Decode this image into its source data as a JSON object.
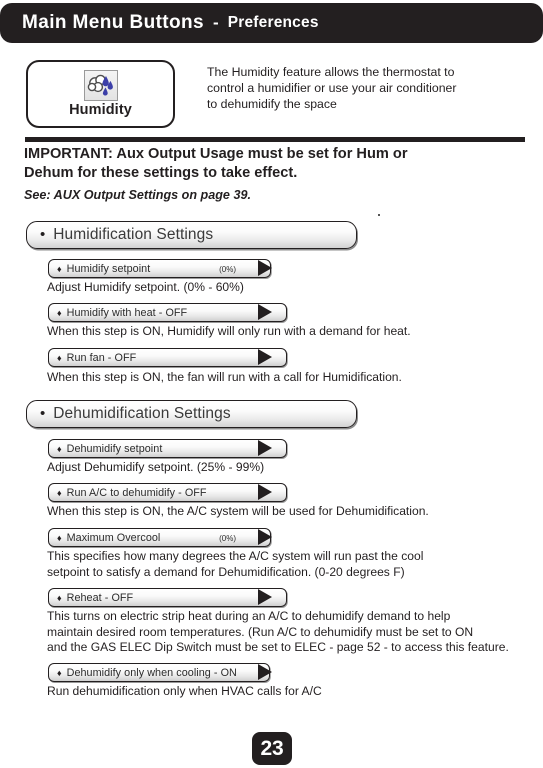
{
  "header": {
    "title": "Main Menu Buttons",
    "separator": "-",
    "subtitle": "Preferences"
  },
  "feature": {
    "icon_name": "humidity-cloud-raindrops-icon",
    "label": "Humidity",
    "description_lines": [
      "The Humidity feature allows the thermostat to",
      "control a humidifier or use your air conditioner",
      "to dehumidify the space"
    ]
  },
  "notice": {
    "important_lines": [
      "IMPORTANT: Aux Output Usage must be set for Hum or",
      "Dehum for these settings to take effect."
    ],
    "see_reference": "See: AUX Output Settings on page 39."
  },
  "sections": [
    {
      "bullet": "•",
      "title": "Humidification Settings",
      "settings": [
        {
          "bullet": "♦",
          "label": "Humidify setpoint",
          "value": "(0%)",
          "arrow": "▶",
          "description_lines": [
            "Adjust Humidify setpoint. (0% - 60%)"
          ]
        },
        {
          "bullet": "♦",
          "label": "Humidify with heat - OFF",
          "value": "",
          "arrow": "▶",
          "description_lines": [
            "When this step is ON, Humidify will only run with a demand for heat."
          ]
        },
        {
          "bullet": "♦",
          "label": "Run fan - OFF",
          "value": "",
          "arrow": "▶",
          "description_lines": [
            "When this step is ON, the fan will run with a call for Humidification."
          ]
        }
      ]
    },
    {
      "bullet": "•",
      "title": "Dehumidification Settings",
      "settings": [
        {
          "bullet": "♦",
          "label": "Dehumidify setpoint",
          "value": "",
          "arrow": "▶",
          "description_lines": [
            "Adjust Dehumidify setpoint. (25% - 99%)"
          ]
        },
        {
          "bullet": "♦",
          "label": "Run A/C to dehumidify - OFF",
          "value": "",
          "arrow": "▶",
          "description_lines": [
            "When this step is ON, the A/C system will be used for Dehumidification."
          ]
        },
        {
          "bullet": "♦",
          "label": "Maximum Overcool",
          "value": "(0%)",
          "arrow": "▶",
          "description_lines": [
            "This specifies how many degrees the A/C system will run past the cool",
            "setpoint to satisfy a demand for Dehumidification. (0-20 degrees F)"
          ]
        },
        {
          "bullet": "♦",
          "label": "Reheat - OFF",
          "value": "",
          "arrow": "▶",
          "description_lines": [
            "This turns on electric strip heat during an A/C to dehumidify demand to help",
            "maintain desired room temperatures. (Run A/C to dehumidify must be set to ON",
            "and the GAS ELEC Dip Switch must be set to ELEC - page 52 - to access this feature."
          ]
        },
        {
          "bullet": "♦",
          "label": "Dehumidify only when cooling - ON",
          "value": "",
          "arrow": "▶",
          "description_lines": [
            "Run dehumidification only when HVAC calls for A/C"
          ]
        }
      ]
    }
  ],
  "footer": {
    "page_number": "23"
  },
  "colors": {
    "ink": "#231f20",
    "page_background": "#ffffff",
    "button_face_top": "#ffffff",
    "button_face_bottom": "#d2d2d2"
  }
}
